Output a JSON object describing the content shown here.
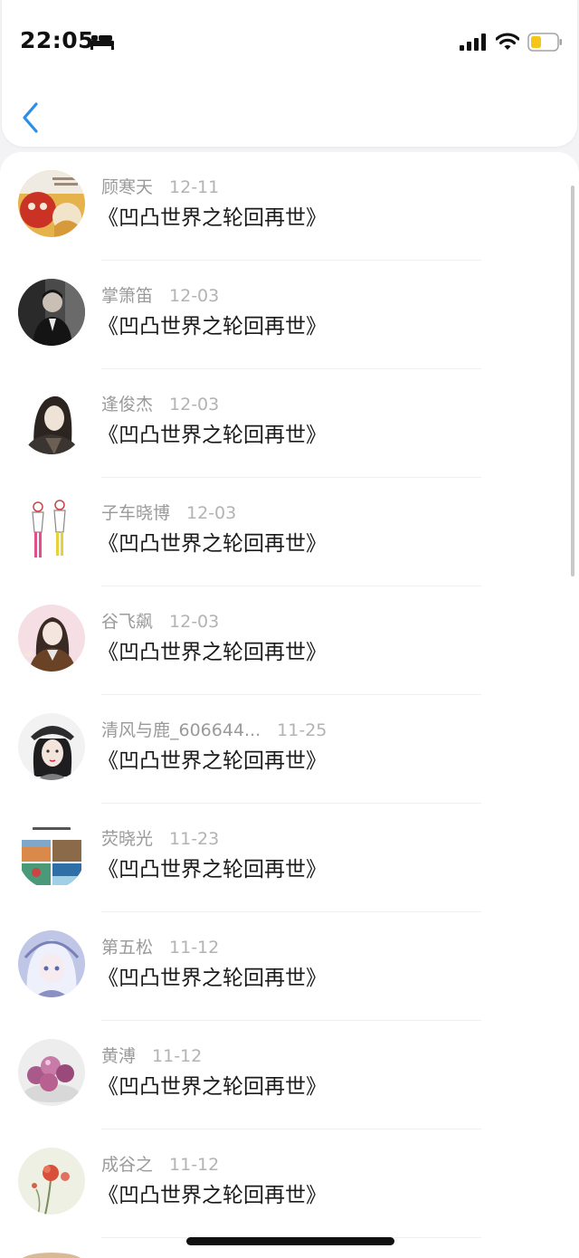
{
  "status_bar": {
    "time": "22:05",
    "icons": [
      "bed-icon",
      "signal-icon",
      "wifi-icon",
      "battery-icon"
    ],
    "battery_color": "#f5c518"
  },
  "nav": {
    "back_icon": "chevron-left-icon",
    "accent_color": "#2d8ee8"
  },
  "items": [
    {
      "name": "顾寒天",
      "date": "12-11",
      "book": "《凹凸世界之轮回再世》",
      "avatar": "avatar-red-mask-illustration"
    },
    {
      "name": "掌箫笛",
      "date": "12-03",
      "book": "《凹凸世界之轮回再世》",
      "avatar": "avatar-dark-photo-man-in-suit"
    },
    {
      "name": "逢俊杰",
      "date": "12-03",
      "book": "《凹凸世界之轮回再世》",
      "avatar": "avatar-long-hair-character"
    },
    {
      "name": "子车晓博",
      "date": "12-03",
      "book": "《凹凸世界之轮回再世》",
      "avatar": "avatar-two-sketch-figures"
    },
    {
      "name": "谷飞飙",
      "date": "12-03",
      "book": "《凹凸世界之轮回再世》",
      "avatar": "avatar-girl-illustration-pink"
    },
    {
      "name": "清风与鹿_606644...",
      "date": "11-25",
      "book": "《凹凸世界之轮回再世》",
      "avatar": "avatar-girl-with-cap"
    },
    {
      "name": "荧晓光",
      "date": "11-23",
      "book": "《凹凸世界之轮回再世》",
      "avatar": "avatar-photo-collage"
    },
    {
      "name": "第五松",
      "date": "11-12",
      "book": "《凹凸世界之轮回再世》",
      "avatar": "avatar-anime-girl-lace"
    },
    {
      "name": "黄溥",
      "date": "11-12",
      "book": "《凹凸世界之轮回再世》",
      "avatar": "avatar-purple-fruits"
    },
    {
      "name": "成谷之",
      "date": "11-12",
      "book": "《凹凸世界之轮回再世》",
      "avatar": "avatar-red-poppy-flower"
    }
  ]
}
